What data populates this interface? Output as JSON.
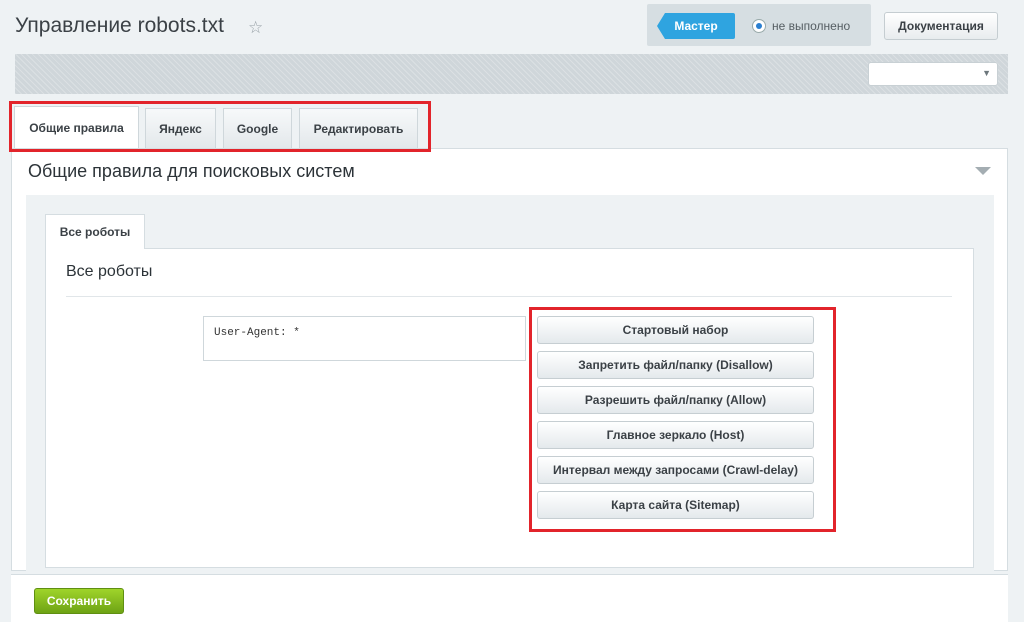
{
  "header": {
    "title": "Управление robots.txt",
    "star_icon": "star-icon",
    "master_label": "Мастер",
    "status_text": "не выполнено",
    "docs_label": "Документация",
    "accent_color": "#2fa4e0"
  },
  "toolbar": {
    "site_select_value": ""
  },
  "tabs": [
    {
      "label": "Общие правила",
      "active": true
    },
    {
      "label": "Яндекс",
      "active": false
    },
    {
      "label": "Google",
      "active": false
    },
    {
      "label": "Редактировать",
      "active": false
    }
  ],
  "section": {
    "title": "Общие правила для поисковых систем",
    "subtab_label": "Все роботы",
    "inner_title": "Все роботы",
    "robots_text": "User-Agent: *"
  },
  "actions": [
    "Стартовый набор",
    "Запретить файл/папку (Disallow)",
    "Разрешить файл/папку (Allow)",
    "Главное зеркало (Host)",
    "Интервал между запросами (Crawl-delay)",
    "Карта сайта (Sitemap)"
  ],
  "footer": {
    "save_label": "Сохранить"
  },
  "colors": {
    "highlight": "#e2242b",
    "save_green": "#7cb518"
  }
}
